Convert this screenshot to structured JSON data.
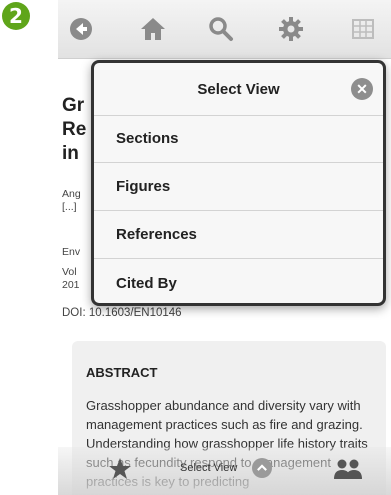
{
  "step_badge": "2",
  "toolbar": {
    "icons": [
      "back-icon",
      "home-icon",
      "search-icon",
      "gear-icon",
      "grid-icon"
    ]
  },
  "article": {
    "title_fragment": "Gr Re in",
    "author_fragment_1": "Ang",
    "author_fragment_2": "[...]",
    "journal_fragment": "Env",
    "volume_fragment": "Vol",
    "year_fragment": "201",
    "doi": "DOI: 10.1603/EN10146"
  },
  "abstract": {
    "heading": "ABSTRACT",
    "text": "Grasshopper abundance and diversity vary with management practices such as fire and grazing. Understanding how grasshopper life history traits such as fecundity respond to management practices is key to predicting"
  },
  "bottom_bar": {
    "label": "Select View",
    "icons": [
      "star-icon",
      "chevron-up-icon",
      "users-icon"
    ]
  },
  "popover": {
    "title": "Select View",
    "close_glyph": "✕",
    "items": [
      "Sections",
      "Figures",
      "References",
      "Cited By"
    ]
  },
  "colors": {
    "badge": "#5fa51a",
    "icon_gray": "#8a8a8a"
  }
}
